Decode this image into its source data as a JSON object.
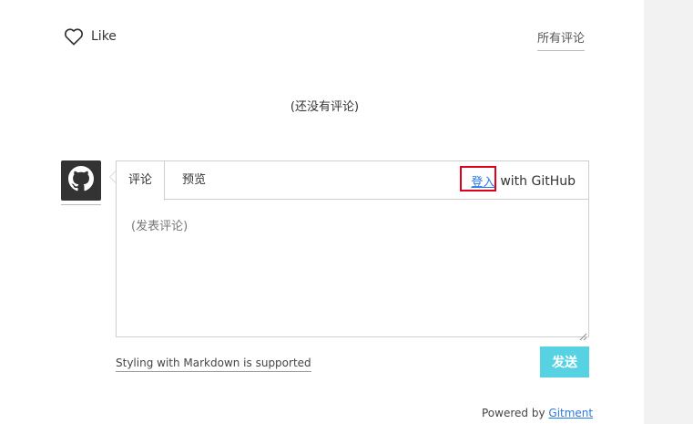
{
  "header": {
    "like_label": "Like",
    "all_comments_label": "所有评论"
  },
  "comments": {
    "empty_text": "(还没有评论)"
  },
  "editor": {
    "tabs": [
      {
        "label": "评论",
        "active": true
      },
      {
        "label": "预览",
        "active": false
      }
    ],
    "login_link_label": "登入",
    "login_suffix": "with GitHub",
    "textarea_placeholder": "(发表评论)",
    "textarea_value": ""
  },
  "footer": {
    "markdown_label": "Styling with Markdown is supported",
    "send_label": "发送",
    "powered_prefix": "Powered by",
    "powered_link": "Gitment"
  },
  "icons": {
    "like": "heart-icon",
    "avatar": "github-icon"
  },
  "colors": {
    "accent": "#57d2e2",
    "link": "#2a7ae2",
    "highlight_box": "#e0001b"
  }
}
